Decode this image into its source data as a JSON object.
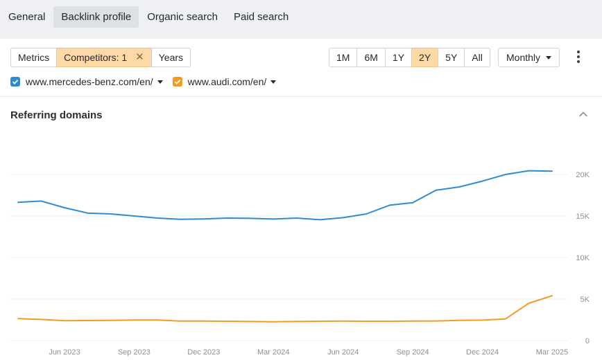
{
  "tabs": [
    {
      "label": "General",
      "active": false
    },
    {
      "label": "Backlink profile",
      "active": true
    },
    {
      "label": "Organic search",
      "active": false
    },
    {
      "label": "Paid search",
      "active": false
    }
  ],
  "toolbar": {
    "modes": [
      "Metrics",
      "Competitors: 1",
      "Years"
    ],
    "active_mode": "Competitors: 1",
    "close_glyph": "✕",
    "ranges": [
      "1M",
      "6M",
      "1Y",
      "2Y",
      "5Y",
      "All"
    ],
    "active_range": "2Y",
    "granularity": "Monthly"
  },
  "sites": [
    {
      "label": "www.mercedes-benz.com/en/",
      "color": "#2f8bd0",
      "checked": true
    },
    {
      "label": "www.audi.com/en/",
      "color": "#f39a21",
      "checked": true
    }
  ],
  "section": {
    "title": "Referring domains"
  },
  "chart_data": {
    "type": "line",
    "title": "Referring domains",
    "x_ticks": [
      "Jun 2023",
      "Sep 2023",
      "Dec 2023",
      "Mar 2024",
      "Jun 2024",
      "Sep 2024",
      "Dec 2024",
      "Mar 2025"
    ],
    "y_ticks": [
      "20K",
      "15K",
      "10K",
      "5K",
      "0"
    ],
    "ylim": [
      0,
      20000
    ],
    "x_months": [
      "Apr 2023",
      "May 2023",
      "Jun 2023",
      "Jul 2023",
      "Aug 2023",
      "Sep 2023",
      "Oct 2023",
      "Nov 2023",
      "Dec 2023",
      "Jan 2024",
      "Feb 2024",
      "Mar 2024",
      "Apr 2024",
      "May 2024",
      "Jun 2024",
      "Jul 2024",
      "Aug 2024",
      "Sep 2024",
      "Oct 2024",
      "Nov 2024",
      "Dec 2024",
      "Jan 2025",
      "Feb 2025",
      "Mar 2025"
    ],
    "grid": true,
    "legend": "top",
    "series": [
      {
        "name": "www.mercedes-benz.com/en/",
        "color": "#2f8bd0",
        "values": [
          16650,
          16800,
          16000,
          15350,
          15250,
          15000,
          14750,
          14600,
          14650,
          14750,
          14720,
          14630,
          14750,
          14550,
          14800,
          15250,
          16300,
          16600,
          18100,
          18500,
          19200,
          20000,
          20450,
          20400
        ]
      },
      {
        "name": "www.audi.com/en/",
        "color": "#f39a21",
        "values": [
          2650,
          2550,
          2400,
          2420,
          2430,
          2480,
          2480,
          2350,
          2350,
          2330,
          2300,
          2270,
          2300,
          2330,
          2350,
          2330,
          2330,
          2350,
          2370,
          2430,
          2470,
          2620,
          4500,
          5400
        ]
      }
    ]
  }
}
